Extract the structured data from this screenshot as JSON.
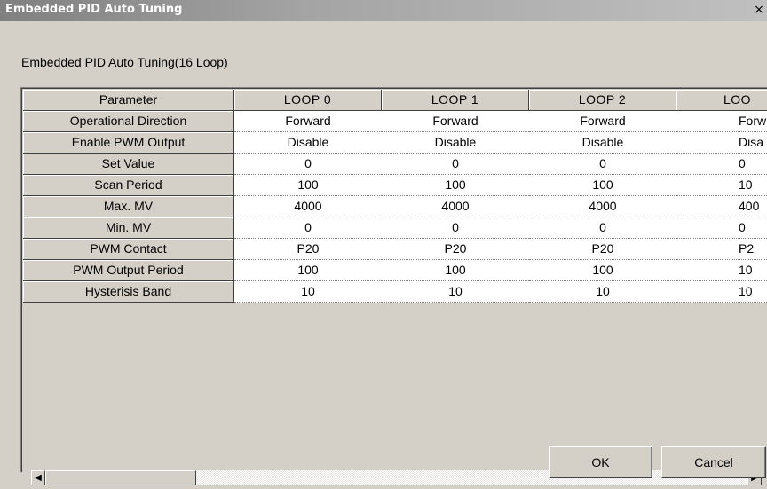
{
  "window": {
    "title": "Embedded PID Auto Tuning",
    "close_glyph": "×"
  },
  "group_label": "Embedded PID Auto Tuning(16 Loop)",
  "table": {
    "header_label": "Parameter",
    "columns": [
      "LOOP 0",
      "LOOP 1",
      "LOOP 2",
      "LOO"
    ],
    "rows": [
      {
        "label": "Operational Direction",
        "values": [
          "Forward",
          "Forward",
          "Forward",
          "Forw"
        ]
      },
      {
        "label": "Enable PWM Output",
        "values": [
          "Disable",
          "Disable",
          "Disable",
          "Disa"
        ]
      },
      {
        "label": "Set Value",
        "values": [
          "0",
          "0",
          "0",
          "0"
        ]
      },
      {
        "label": "Scan Period",
        "values": [
          "100",
          "100",
          "100",
          "10"
        ]
      },
      {
        "label": "Max. MV",
        "values": [
          "4000",
          "4000",
          "4000",
          "400"
        ]
      },
      {
        "label": "Min. MV",
        "values": [
          "0",
          "0",
          "0",
          "0"
        ]
      },
      {
        "label": "PWM Contact",
        "values": [
          "P20",
          "P20",
          "P20",
          "P2"
        ]
      },
      {
        "label": "PWM Output Period",
        "values": [
          "100",
          "100",
          "100",
          "10"
        ]
      },
      {
        "label": "Hysterisis Band",
        "values": [
          "10",
          "10",
          "10",
          "10"
        ]
      }
    ]
  },
  "scrollbar": {
    "left_arrow": "◀",
    "right_arrow": "▶"
  },
  "buttons": {
    "ok": "OK",
    "cancel": "Cancel"
  }
}
